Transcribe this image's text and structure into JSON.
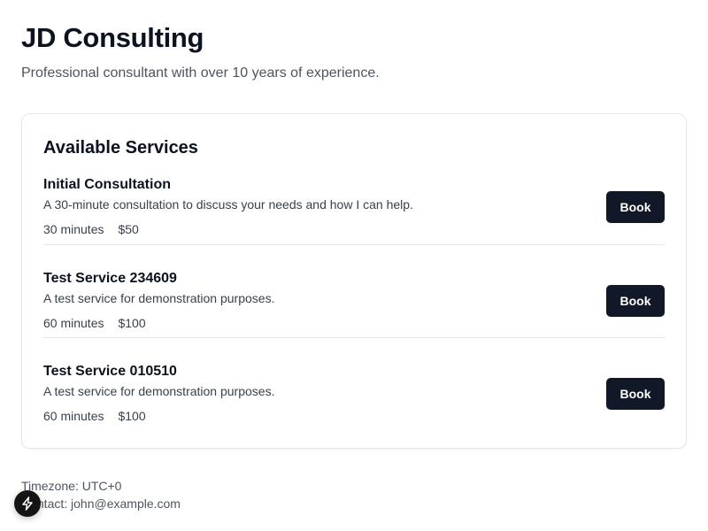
{
  "header": {
    "title": "JD Consulting",
    "subtitle": "Professional consultant with over 10 years of experience."
  },
  "services_card": {
    "title": "Available Services",
    "services": [
      {
        "name": "Initial Consultation",
        "description": "A 30-minute consultation to discuss your needs and how I can help.",
        "duration": "30 minutes",
        "price": "$50",
        "button_label": "Book"
      },
      {
        "name": "Test Service 234609",
        "description": "A test service for demonstration purposes.",
        "duration": "60 minutes",
        "price": "$100",
        "button_label": "Book"
      },
      {
        "name": "Test Service 010510",
        "description": "A test service for demonstration purposes.",
        "duration": "60 minutes",
        "price": "$100",
        "button_label": "Book"
      }
    ]
  },
  "footer": {
    "timezone": "Timezone: UTC+0",
    "contact": "Contact: john@example.com"
  },
  "dev_badge": {
    "icon": "lightning-bolt-icon"
  },
  "colors": {
    "button_bg": "#111827",
    "border": "#e5e7eb",
    "muted_text": "#4b5563"
  }
}
